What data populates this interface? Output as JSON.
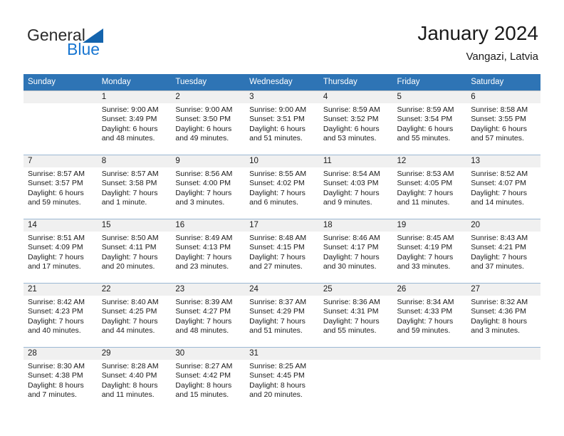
{
  "brand": {
    "name_part1": "General",
    "name_part2": "Blue",
    "logo_icon": "triangle-logo-icon",
    "accent_color": "#1876d1"
  },
  "header": {
    "title": "January 2024",
    "location": "Vangazi, Latvia"
  },
  "theme": {
    "header_blue": "#2e74b5",
    "daynum_band_gray": "#f0f0f0",
    "row_border": "#9bb8d4",
    "text": "#1a1a1a"
  },
  "calendar": {
    "weekday_headers": [
      "Sunday",
      "Monday",
      "Tuesday",
      "Wednesday",
      "Thursday",
      "Friday",
      "Saturday"
    ],
    "weeks": [
      [
        {
          "day": "",
          "sunrise": "",
          "sunset": "",
          "daylight1": "",
          "daylight2": ""
        },
        {
          "day": "1",
          "sunrise": "Sunrise: 9:00 AM",
          "sunset": "Sunset: 3:49 PM",
          "daylight1": "Daylight: 6 hours",
          "daylight2": "and 48 minutes."
        },
        {
          "day": "2",
          "sunrise": "Sunrise: 9:00 AM",
          "sunset": "Sunset: 3:50 PM",
          "daylight1": "Daylight: 6 hours",
          "daylight2": "and 49 minutes."
        },
        {
          "day": "3",
          "sunrise": "Sunrise: 9:00 AM",
          "sunset": "Sunset: 3:51 PM",
          "daylight1": "Daylight: 6 hours",
          "daylight2": "and 51 minutes."
        },
        {
          "day": "4",
          "sunrise": "Sunrise: 8:59 AM",
          "sunset": "Sunset: 3:52 PM",
          "daylight1": "Daylight: 6 hours",
          "daylight2": "and 53 minutes."
        },
        {
          "day": "5",
          "sunrise": "Sunrise: 8:59 AM",
          "sunset": "Sunset: 3:54 PM",
          "daylight1": "Daylight: 6 hours",
          "daylight2": "and 55 minutes."
        },
        {
          "day": "6",
          "sunrise": "Sunrise: 8:58 AM",
          "sunset": "Sunset: 3:55 PM",
          "daylight1": "Daylight: 6 hours",
          "daylight2": "and 57 minutes."
        }
      ],
      [
        {
          "day": "7",
          "sunrise": "Sunrise: 8:57 AM",
          "sunset": "Sunset: 3:57 PM",
          "daylight1": "Daylight: 6 hours",
          "daylight2": "and 59 minutes."
        },
        {
          "day": "8",
          "sunrise": "Sunrise: 8:57 AM",
          "sunset": "Sunset: 3:58 PM",
          "daylight1": "Daylight: 7 hours",
          "daylight2": "and 1 minute."
        },
        {
          "day": "9",
          "sunrise": "Sunrise: 8:56 AM",
          "sunset": "Sunset: 4:00 PM",
          "daylight1": "Daylight: 7 hours",
          "daylight2": "and 3 minutes."
        },
        {
          "day": "10",
          "sunrise": "Sunrise: 8:55 AM",
          "sunset": "Sunset: 4:02 PM",
          "daylight1": "Daylight: 7 hours",
          "daylight2": "and 6 minutes."
        },
        {
          "day": "11",
          "sunrise": "Sunrise: 8:54 AM",
          "sunset": "Sunset: 4:03 PM",
          "daylight1": "Daylight: 7 hours",
          "daylight2": "and 9 minutes."
        },
        {
          "day": "12",
          "sunrise": "Sunrise: 8:53 AM",
          "sunset": "Sunset: 4:05 PM",
          "daylight1": "Daylight: 7 hours",
          "daylight2": "and 11 minutes."
        },
        {
          "day": "13",
          "sunrise": "Sunrise: 8:52 AM",
          "sunset": "Sunset: 4:07 PM",
          "daylight1": "Daylight: 7 hours",
          "daylight2": "and 14 minutes."
        }
      ],
      [
        {
          "day": "14",
          "sunrise": "Sunrise: 8:51 AM",
          "sunset": "Sunset: 4:09 PM",
          "daylight1": "Daylight: 7 hours",
          "daylight2": "and 17 minutes."
        },
        {
          "day": "15",
          "sunrise": "Sunrise: 8:50 AM",
          "sunset": "Sunset: 4:11 PM",
          "daylight1": "Daylight: 7 hours",
          "daylight2": "and 20 minutes."
        },
        {
          "day": "16",
          "sunrise": "Sunrise: 8:49 AM",
          "sunset": "Sunset: 4:13 PM",
          "daylight1": "Daylight: 7 hours",
          "daylight2": "and 23 minutes."
        },
        {
          "day": "17",
          "sunrise": "Sunrise: 8:48 AM",
          "sunset": "Sunset: 4:15 PM",
          "daylight1": "Daylight: 7 hours",
          "daylight2": "and 27 minutes."
        },
        {
          "day": "18",
          "sunrise": "Sunrise: 8:46 AM",
          "sunset": "Sunset: 4:17 PM",
          "daylight1": "Daylight: 7 hours",
          "daylight2": "and 30 minutes."
        },
        {
          "day": "19",
          "sunrise": "Sunrise: 8:45 AM",
          "sunset": "Sunset: 4:19 PM",
          "daylight1": "Daylight: 7 hours",
          "daylight2": "and 33 minutes."
        },
        {
          "day": "20",
          "sunrise": "Sunrise: 8:43 AM",
          "sunset": "Sunset: 4:21 PM",
          "daylight1": "Daylight: 7 hours",
          "daylight2": "and 37 minutes."
        }
      ],
      [
        {
          "day": "21",
          "sunrise": "Sunrise: 8:42 AM",
          "sunset": "Sunset: 4:23 PM",
          "daylight1": "Daylight: 7 hours",
          "daylight2": "and 40 minutes."
        },
        {
          "day": "22",
          "sunrise": "Sunrise: 8:40 AM",
          "sunset": "Sunset: 4:25 PM",
          "daylight1": "Daylight: 7 hours",
          "daylight2": "and 44 minutes."
        },
        {
          "day": "23",
          "sunrise": "Sunrise: 8:39 AM",
          "sunset": "Sunset: 4:27 PM",
          "daylight1": "Daylight: 7 hours",
          "daylight2": "and 48 minutes."
        },
        {
          "day": "24",
          "sunrise": "Sunrise: 8:37 AM",
          "sunset": "Sunset: 4:29 PM",
          "daylight1": "Daylight: 7 hours",
          "daylight2": "and 51 minutes."
        },
        {
          "day": "25",
          "sunrise": "Sunrise: 8:36 AM",
          "sunset": "Sunset: 4:31 PM",
          "daylight1": "Daylight: 7 hours",
          "daylight2": "and 55 minutes."
        },
        {
          "day": "26",
          "sunrise": "Sunrise: 8:34 AM",
          "sunset": "Sunset: 4:33 PM",
          "daylight1": "Daylight: 7 hours",
          "daylight2": "and 59 minutes."
        },
        {
          "day": "27",
          "sunrise": "Sunrise: 8:32 AM",
          "sunset": "Sunset: 4:36 PM",
          "daylight1": "Daylight: 8 hours",
          "daylight2": "and 3 minutes."
        }
      ],
      [
        {
          "day": "28",
          "sunrise": "Sunrise: 8:30 AM",
          "sunset": "Sunset: 4:38 PM",
          "daylight1": "Daylight: 8 hours",
          "daylight2": "and 7 minutes."
        },
        {
          "day": "29",
          "sunrise": "Sunrise: 8:28 AM",
          "sunset": "Sunset: 4:40 PM",
          "daylight1": "Daylight: 8 hours",
          "daylight2": "and 11 minutes."
        },
        {
          "day": "30",
          "sunrise": "Sunrise: 8:27 AM",
          "sunset": "Sunset: 4:42 PM",
          "daylight1": "Daylight: 8 hours",
          "daylight2": "and 15 minutes."
        },
        {
          "day": "31",
          "sunrise": "Sunrise: 8:25 AM",
          "sunset": "Sunset: 4:45 PM",
          "daylight1": "Daylight: 8 hours",
          "daylight2": "and 20 minutes."
        },
        {
          "day": "",
          "sunrise": "",
          "sunset": "",
          "daylight1": "",
          "daylight2": ""
        },
        {
          "day": "",
          "sunrise": "",
          "sunset": "",
          "daylight1": "",
          "daylight2": ""
        },
        {
          "day": "",
          "sunrise": "",
          "sunset": "",
          "daylight1": "",
          "daylight2": ""
        }
      ]
    ]
  }
}
